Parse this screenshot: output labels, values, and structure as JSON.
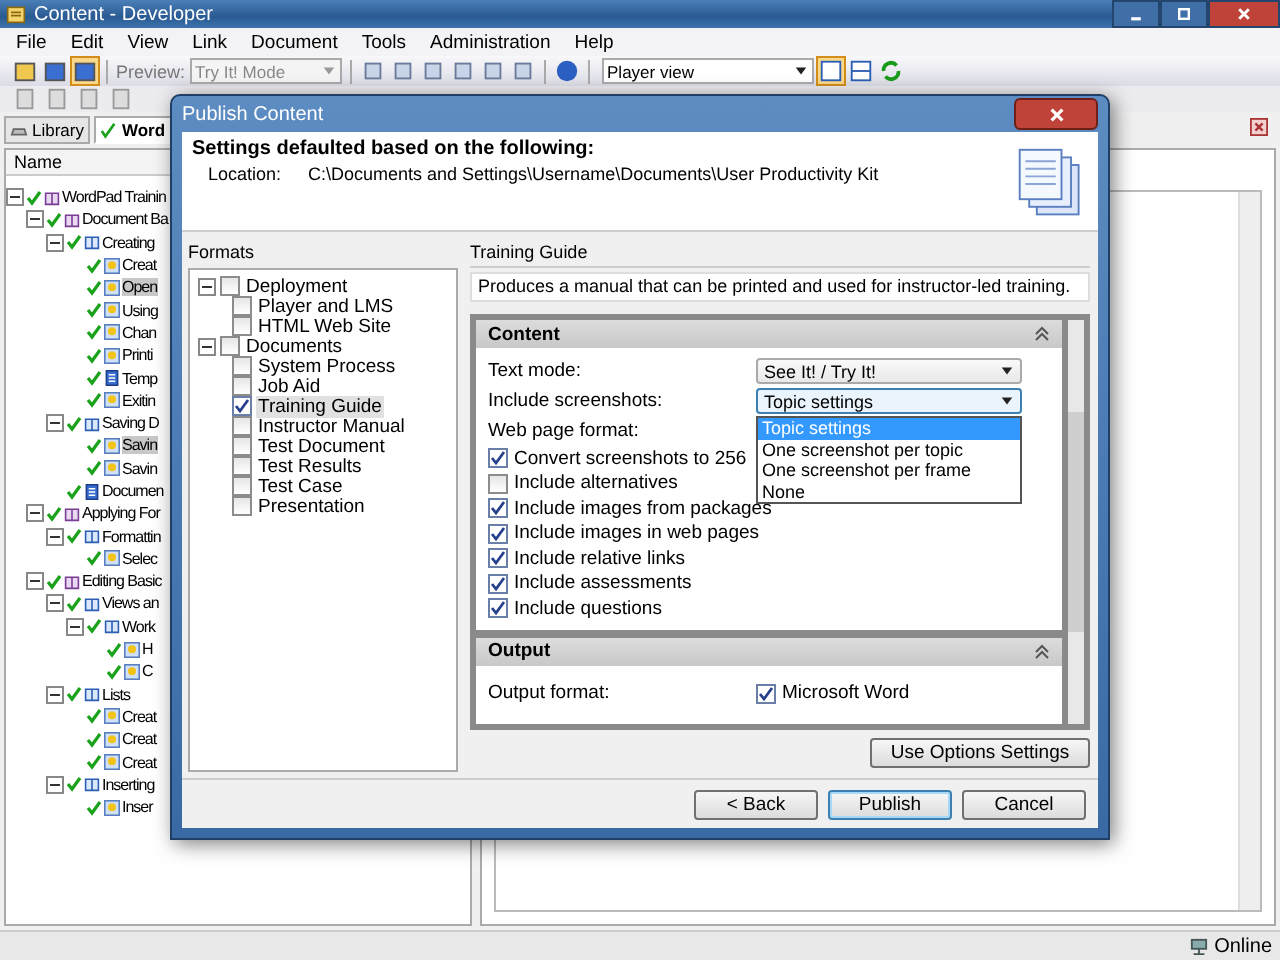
{
  "window": {
    "title": "Content - Developer"
  },
  "menu": [
    "File",
    "Edit",
    "View",
    "Link",
    "Document",
    "Tools",
    "Administration",
    "Help"
  ],
  "toolbar": {
    "preview_label": "Preview:",
    "mode_select": "Try It! Mode",
    "view_select": "Player view"
  },
  "tabs": [
    {
      "label": "Library",
      "selected": false
    },
    {
      "label": "Word",
      "selected": true
    }
  ],
  "tree": {
    "column": "Name",
    "items": [
      {
        "label": "WordPad Trainin",
        "kind": "module",
        "selected": false,
        "children": [
          {
            "label": "Document Ba",
            "kind": "module",
            "selected": false,
            "children": [
              {
                "label": "Creating",
                "kind": "section",
                "selected": false,
                "children": [
                  {
                    "label": "Creat",
                    "kind": "topic",
                    "selected": false
                  },
                  {
                    "label": "Open",
                    "kind": "topic",
                    "selected": true
                  },
                  {
                    "label": "Using",
                    "kind": "topic",
                    "selected": false
                  },
                  {
                    "label": "Chan",
                    "kind": "topic",
                    "selected": false
                  },
                  {
                    "label": "Printi",
                    "kind": "topic",
                    "selected": false
                  },
                  {
                    "label": "Temp",
                    "kind": "document",
                    "selected": false
                  },
                  {
                    "label": "Exitin",
                    "kind": "topic",
                    "selected": false
                  }
                ]
              },
              {
                "label": "Saving D",
                "kind": "section",
                "selected": false,
                "children": [
                  {
                    "label": "Savin",
                    "kind": "topic",
                    "selected": true
                  },
                  {
                    "label": "Savin",
                    "kind": "topic",
                    "selected": false
                  }
                ]
              },
              {
                "label": "Documen",
                "kind": "document",
                "selected": false
              }
            ]
          },
          {
            "label": "Applying For",
            "kind": "module",
            "selected": false,
            "children": [
              {
                "label": "Formattin",
                "kind": "section",
                "selected": false,
                "children": [
                  {
                    "label": "Selec",
                    "kind": "topic",
                    "selected": false
                  }
                ]
              }
            ]
          },
          {
            "label": "Editing Basic",
            "kind": "module",
            "selected": false,
            "children": [
              {
                "label": "Views an",
                "kind": "section",
                "selected": false,
                "children": [
                  {
                    "label": "Work",
                    "kind": "section",
                    "selected": false,
                    "children": [
                      {
                        "label": "H",
                        "kind": "topic",
                        "selected": false
                      },
                      {
                        "label": "C",
                        "kind": "topic",
                        "selected": false
                      }
                    ]
                  }
                ]
              },
              {
                "label": "Lists",
                "kind": "section",
                "selected": false,
                "children": [
                  {
                    "label": "Creat",
                    "kind": "topic",
                    "selected": false
                  },
                  {
                    "label": "Creat",
                    "kind": "topic",
                    "selected": false
                  },
                  {
                    "label": "Creat",
                    "kind": "topic",
                    "selected": false
                  }
                ]
              },
              {
                "label": "Inserting",
                "kind": "section",
                "selected": false,
                "children": [
                  {
                    "label": "Inser",
                    "kind": "topic",
                    "selected": false
                  }
                ]
              }
            ]
          }
        ]
      }
    ]
  },
  "status_bar": {
    "status": "Online"
  },
  "dialog": {
    "title": "Publish Content",
    "heading": "Settings defaulted based on the following:",
    "location_label": "Location:",
    "location": "C:\\Documents and Settings\\Username\\Documents\\User Productivity Kit",
    "formats_label": "Formats",
    "formats": [
      {
        "label": "Deployment",
        "checked": false,
        "selected": false,
        "children": [
          {
            "label": "Player and LMS",
            "checked": false,
            "selected": false
          },
          {
            "label": "HTML Web Site",
            "checked": false,
            "selected": false
          }
        ]
      },
      {
        "label": "Documents",
        "checked": false,
        "selected": false,
        "children": [
          {
            "label": "System Process",
            "checked": false,
            "selected": false
          },
          {
            "label": "Job Aid",
            "checked": false,
            "selected": false
          },
          {
            "label": "Training Guide",
            "checked": true,
            "selected": true
          },
          {
            "label": "Instructor Manual",
            "checked": false,
            "selected": false
          },
          {
            "label": "Test Document",
            "checked": false,
            "selected": false
          },
          {
            "label": "Test Results",
            "checked": false,
            "selected": false
          },
          {
            "label": "Test Case",
            "checked": false,
            "selected": false
          },
          {
            "label": "Presentation",
            "checked": false,
            "selected": false
          }
        ]
      }
    ],
    "format_title": "Training Guide",
    "description": "Produces a manual that can be printed and used for instructor-led training.",
    "sections": [
      {
        "title": "Content",
        "fields": [
          {
            "kind": "select",
            "label": "Text mode:",
            "value": "See It! / Try It!"
          },
          {
            "kind": "select",
            "label": "Include screenshots:",
            "value": "Topic settings",
            "open": true,
            "options": [
              {
                "label": "Topic settings",
                "selected": true
              },
              {
                "label": "One screenshot per topic",
                "selected": false
              },
              {
                "label": "One screenshot per frame",
                "selected": false
              },
              {
                "label": "None",
                "selected": false
              }
            ]
          },
          {
            "kind": "label",
            "label": "Web page format:"
          },
          {
            "kind": "checkbox",
            "label": "Convert screenshots to 256",
            "checked": true
          },
          {
            "kind": "checkbox",
            "label": "Include alternatives",
            "checked": false
          },
          {
            "kind": "checkbox",
            "label": "Include images from packages",
            "checked": true
          },
          {
            "kind": "checkbox",
            "label": "Include images in web pages",
            "checked": true
          },
          {
            "kind": "checkbox",
            "label": "Include relative links",
            "checked": true
          },
          {
            "kind": "checkbox",
            "label": "Include assessments",
            "checked": true
          },
          {
            "kind": "checkbox",
            "label": "Include questions",
            "checked": true
          }
        ]
      },
      {
        "title": "Output",
        "fields": [
          {
            "kind": "checkgroup",
            "label": "Output format:",
            "options": [
              {
                "label": "Microsoft Word",
                "checked": true
              }
            ]
          }
        ]
      }
    ],
    "options_button": "Use Options Settings",
    "buttons": [
      {
        "label": "< Back",
        "default": false
      },
      {
        "label": "Publish",
        "default": true
      },
      {
        "label": "Cancel",
        "default": false
      }
    ]
  }
}
